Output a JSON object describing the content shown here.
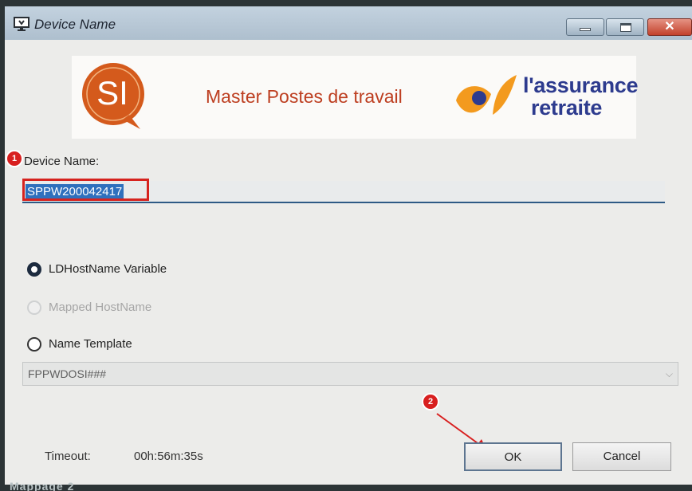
{
  "window": {
    "title": "Device Name",
    "icon": "device-monitor-icon",
    "controls": [
      "minimize-icon",
      "maximize-icon",
      "close-icon"
    ],
    "close_glyph": "✕"
  },
  "banner": {
    "si_logo_text": "SI",
    "title": "Master Postes de travail",
    "brand_line1": "l'assurance",
    "brand_line2": "retraite"
  },
  "markers": [
    "1",
    "2"
  ],
  "device_name": {
    "label": "Device Name:",
    "value": "SPPW200042417"
  },
  "options": [
    {
      "label": "LDHostName Variable",
      "checked": true,
      "enabled": true
    },
    {
      "label": "Mapped HostName",
      "checked": false,
      "enabled": false
    },
    {
      "label": "Name Template",
      "checked": false,
      "enabled": true
    }
  ],
  "template": {
    "value": "FPPWDOSI###",
    "chevron": "⌵"
  },
  "footer": {
    "timeout_label": "Timeout:",
    "timeout_value": "00h:56m:35s",
    "ok_label": "OK",
    "cancel_label": "Cancel"
  },
  "background_taskbar_text": "Mappage 2",
  "colors": {
    "titlebar": "#aebfce",
    "selection": "#2f70bd",
    "annotation_red": "#d81f1f",
    "si_orange": "#d45a1c",
    "brand_blue": "#2d3b8e",
    "brand_orange": "#f39a1e"
  }
}
